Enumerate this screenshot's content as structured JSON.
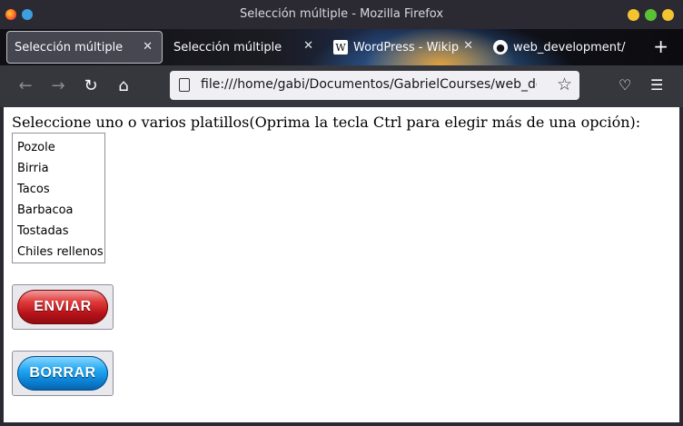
{
  "window": {
    "title": "Selección múltiple - Mozilla Firefox",
    "colors": {
      "close": "#f4c430",
      "minimize": "#f4c430",
      "maximize": "#5bc236",
      "active_dot": "#3d9ee0"
    }
  },
  "tabs": [
    {
      "label": "Selección múltiple",
      "active": true,
      "icon": "none"
    },
    {
      "label": "Selección múltiple",
      "active": false,
      "icon": "none"
    },
    {
      "label": "WordPress - Wikip",
      "active": false,
      "icon": "wikipedia-icon"
    },
    {
      "label": "web_development/",
      "active": false,
      "icon": "github-icon"
    }
  ],
  "navbar": {
    "url": "file:///home/gabi/Documentos/GabrielCourses/web_develo"
  },
  "page": {
    "prompt": "Seleccione uno o varios platillos(Oprima la tecla Ctrl para elegir más de una opción):",
    "options": [
      "Pozole",
      "Birria",
      "Tacos",
      "Barbacoa",
      "Tostadas",
      "Chiles rellenos"
    ],
    "submit_label": "ENVIAR",
    "reset_label": "BORRAR"
  }
}
